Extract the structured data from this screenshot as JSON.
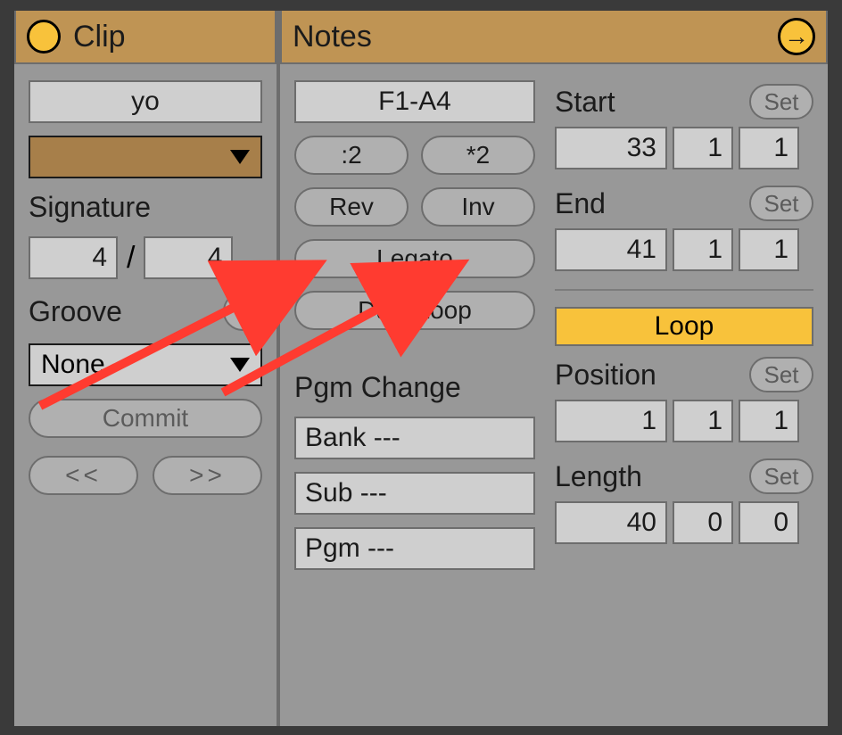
{
  "clip": {
    "title": "Clip",
    "name": "yo",
    "signature_label": "Signature",
    "sig_num": "4",
    "sig_den": "4",
    "groove_label": "Groove",
    "groove_value": "None",
    "commit": "Commit",
    "prev": "<<",
    "next": ">>"
  },
  "notes": {
    "title": "Notes",
    "range": "F1-A4",
    "half": ":2",
    "double": "*2",
    "rev": "Rev",
    "inv": "Inv",
    "legato": "Legato",
    "dupl": "Dupl.Loop",
    "pgm_change_label": "Pgm Change",
    "bank": "Bank ---",
    "sub": "Sub ---",
    "pgm": "Pgm ---"
  },
  "loop": {
    "start_label": "Start",
    "start": [
      "33",
      "1",
      "1"
    ],
    "end_label": "End",
    "end": [
      "41",
      "1",
      "1"
    ],
    "loop_label": "Loop",
    "position_label": "Position",
    "position": [
      "1",
      "1",
      "1"
    ],
    "length_label": "Length",
    "length": [
      "40",
      "0",
      "0"
    ],
    "set": "Set"
  }
}
